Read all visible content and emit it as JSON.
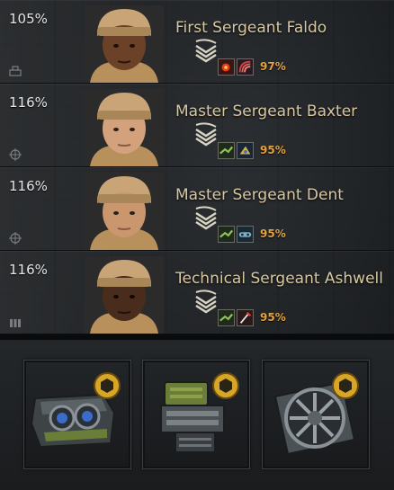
{
  "crew": [
    {
      "percent": "105%",
      "name": "First Sergeant Faldo",
      "skill_percent": "97%",
      "role_icon": "commander-icon",
      "skin": "#6b4128",
      "skills": [
        "recon-icon",
        "radio-icon"
      ]
    },
    {
      "percent": "116%",
      "name": "Master Sergeant Baxter",
      "skill_percent": "95%",
      "role_icon": "gunner-crosshair-icon",
      "skin": "#d3a27c",
      "skills": [
        "camouflage-icon",
        "sixth-sense-icon"
      ]
    },
    {
      "percent": "116%",
      "name": "Master Sergeant Dent",
      "skill_percent": "95%",
      "role_icon": "gunner-crosshair-icon",
      "skin": "#c9966e",
      "skills": [
        "camouflage-icon",
        "track-icon"
      ]
    },
    {
      "percent": "116%",
      "name": "Technical Sergeant Ashwell",
      "skill_percent": "95%",
      "role_icon": "loader-ammo-icon",
      "skin": "#4a2c1c",
      "skills": [
        "camouflage-icon",
        "repair-icon"
      ]
    }
  ],
  "equipment": [
    {
      "name": "binocular-telescope-icon"
    },
    {
      "name": "gun-rammer-icon"
    },
    {
      "name": "ventilation-icon"
    }
  ],
  "colors": {
    "name_text": "#d8c8a2",
    "skill_percent": "#e3a23e",
    "percent_text": "#e6e6e6",
    "gold_nut": "#d8a626"
  }
}
